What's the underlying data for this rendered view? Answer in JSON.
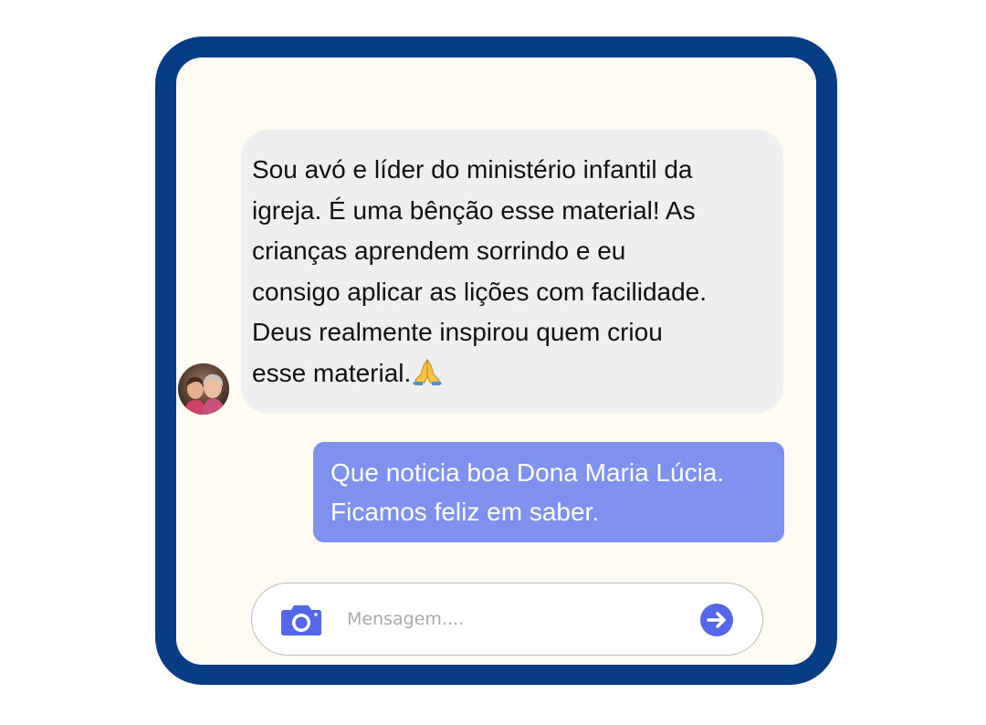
{
  "chat": {
    "incoming": {
      "line1": "Sou avó e líder do ministério infantil da",
      "line2": "igreja. É uma bênção esse material! As",
      "line3": "crianças aprendem sorrindo e eu",
      "line4": "consigo aplicar as lições com facilidade.",
      "line5": "Deus realmente inspirou quem criou",
      "line6": "esse material."
    },
    "outgoing": {
      "line1": "Que noticia boa Dona Maria Lúcia.",
      "line2": "Ficamos feliz em saber."
    }
  },
  "composer": {
    "placeholder": "Mensagem....",
    "camera_icon": "camera-icon",
    "send_icon": "arrow-right-circle-icon"
  },
  "colors": {
    "frame": "#063d84",
    "screen": "#fdfbf2",
    "incoming_bubble": "#efefef",
    "outgoing_bubble": "#7f91ef",
    "icon_accent": "#5367ea"
  }
}
